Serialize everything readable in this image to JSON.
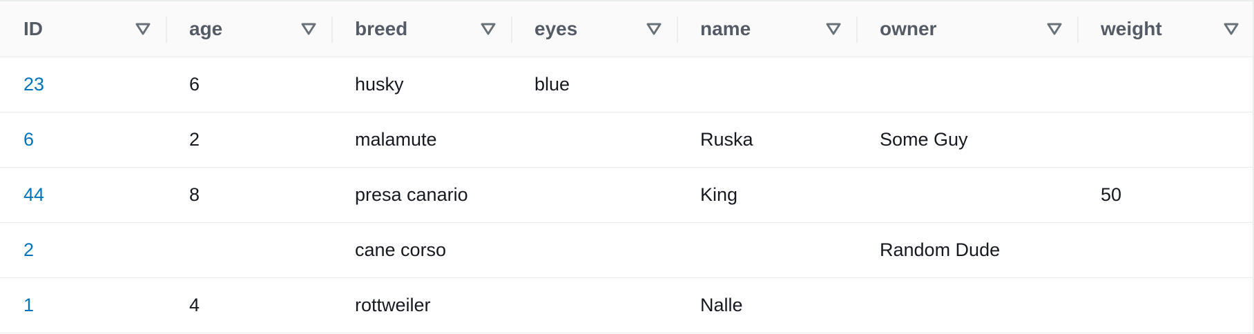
{
  "table": {
    "columns": [
      {
        "label": "ID",
        "sort_icon": "sort-down-triangle-icon"
      },
      {
        "label": "age",
        "sort_icon": "sort-down-triangle-icon"
      },
      {
        "label": "breed",
        "sort_icon": "sort-down-triangle-icon"
      },
      {
        "label": "eyes",
        "sort_icon": "sort-down-triangle-icon"
      },
      {
        "label": "name",
        "sort_icon": "sort-down-triangle-icon"
      },
      {
        "label": "owner",
        "sort_icon": "sort-down-triangle-icon"
      },
      {
        "label": "weight",
        "sort_icon": "sort-down-triangle-icon"
      }
    ],
    "rows": [
      {
        "id": "23",
        "age": "6",
        "breed": "husky",
        "eyes": "blue",
        "name": "",
        "owner": "",
        "weight": ""
      },
      {
        "id": "6",
        "age": "2",
        "breed": "malamute",
        "eyes": "",
        "name": "Ruska",
        "owner": "Some Guy",
        "weight": ""
      },
      {
        "id": "44",
        "age": "8",
        "breed": "presa canario",
        "eyes": "",
        "name": "King",
        "owner": "",
        "weight": "50"
      },
      {
        "id": "2",
        "age": "",
        "breed": "cane corso",
        "eyes": "",
        "name": "",
        "owner": "Random Dude",
        "weight": ""
      },
      {
        "id": "1",
        "age": "4",
        "breed": "rottweiler",
        "eyes": "",
        "name": "Nalle",
        "owner": "",
        "weight": ""
      }
    ]
  },
  "colors": {
    "link": "#0073bb",
    "header_text": "#545b64",
    "body_text": "#16191f",
    "divider": "#eaeded",
    "header_bg": "#fafafa"
  }
}
